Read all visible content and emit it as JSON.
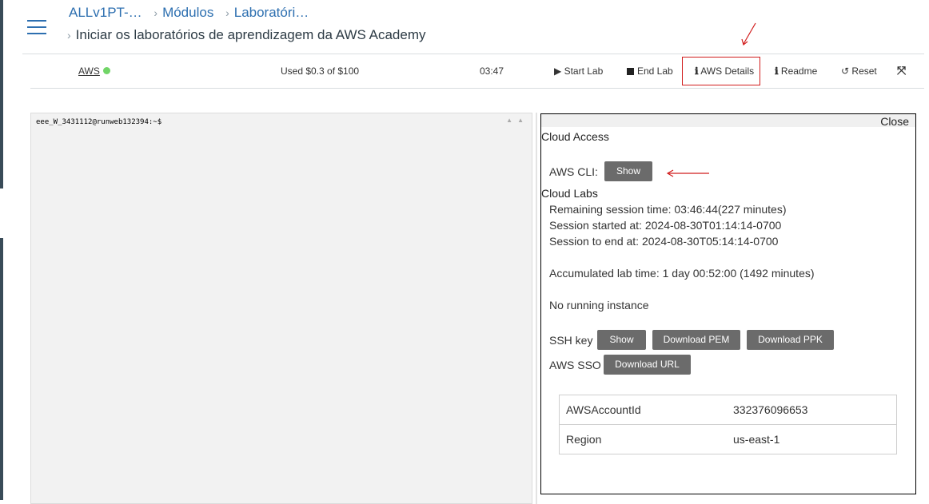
{
  "breadcrumb": {
    "course": "ALLv1PT-…",
    "modules": "Módulos",
    "lab": "Laboratóri…",
    "current": "Iniciar os laboratórios de aprendizagem da AWS Academy",
    "sep": "›"
  },
  "toolbar": {
    "aws_label": "AWS",
    "aws_status_color": "#71d567",
    "budget": "Used $0.3 of $100",
    "timer": "03:47",
    "start_lab": "Start Lab",
    "end_lab": "End Lab",
    "aws_details": "AWS Details",
    "readme": "Readme",
    "reset": "Reset",
    "expand_icon": "expand-arrows-icon"
  },
  "terminal": {
    "prompt": "eee_W_3431112@runweb132394:~$"
  },
  "panel": {
    "close": "Close",
    "cloud_access_title": "Cloud Access",
    "aws_cli_label": "AWS CLI:",
    "show_button": "Show",
    "cloud_labs_title": "Cloud Labs",
    "remaining": "Remaining session time: 03:46:44(227 minutes)",
    "started": "Session started at: 2024-08-30T01:14:14-0700",
    "to_end": "Session to end  at: 2024-08-30T05:14:14-0700",
    "accumulated": "Accumulated lab time: 1 day 00:52:00 (1492 minutes)",
    "no_instance": "No running instance",
    "ssh_key_label": "SSH key",
    "ssh_show": "Show",
    "download_pem": "Download PEM",
    "download_ppk": "Download PPK",
    "aws_sso_label": "AWS SSO",
    "download_url": "Download URL",
    "table": [
      {
        "key": "AWSAccountId",
        "value": "332376096653"
      },
      {
        "key": "Region",
        "value": "us-east-1"
      }
    ]
  },
  "annotation_color": "#d11c1c"
}
